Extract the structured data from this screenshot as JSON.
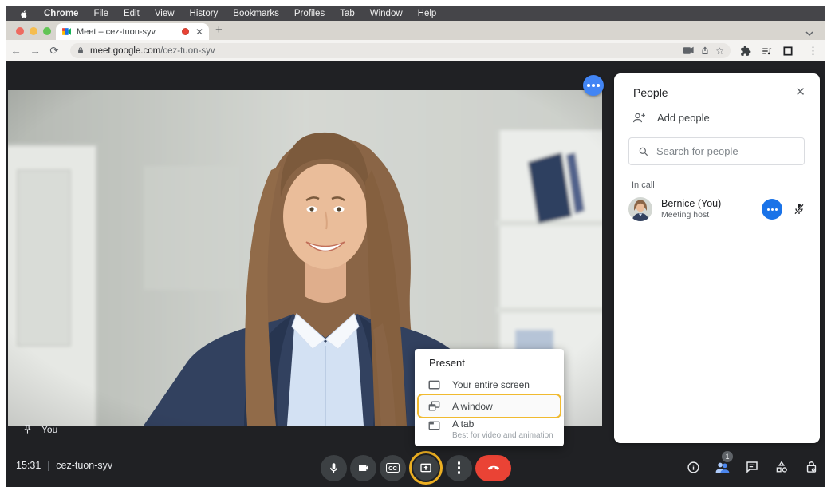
{
  "menubar": {
    "items": [
      "Chrome",
      "File",
      "Edit",
      "View",
      "History",
      "Bookmarks",
      "Profiles",
      "Tab",
      "Window",
      "Help"
    ]
  },
  "browser": {
    "tab_title": "Meet – cez-tuon-syv",
    "url_domain": "meet.google.com",
    "url_path": "/cez-tuon-syv",
    "new_tab": "+"
  },
  "meeting": {
    "time": "15:31",
    "code": "cez-tuon-syv",
    "you_label": "You",
    "cc_label": "CC"
  },
  "present_menu": {
    "title": "Present",
    "items": [
      {
        "label": "Your entire screen"
      },
      {
        "label": "A window",
        "highlighted": true
      },
      {
        "label": "A tab",
        "sublabel": "Best for video and animation"
      }
    ]
  },
  "people_panel": {
    "title": "People",
    "add_people_label": "Add people",
    "search_placeholder": "Search for people",
    "in_call_label": "In call",
    "participant": {
      "name": "Bernice (You)",
      "role": "Meeting host"
    },
    "participants_badge": "1"
  },
  "icons": {
    "highlighted_controls": [
      "present-now-button",
      "present-a-window-item"
    ],
    "muted_participant": "mic-off-icon"
  },
  "colors": {
    "accent_blue": "#1a73e8",
    "video_button_blue": "#4285f4",
    "highlight_yellow": "#ecaf22",
    "end_call_red": "#ea4335",
    "dark_bg": "#202124",
    "control_gray": "#3c4043"
  }
}
